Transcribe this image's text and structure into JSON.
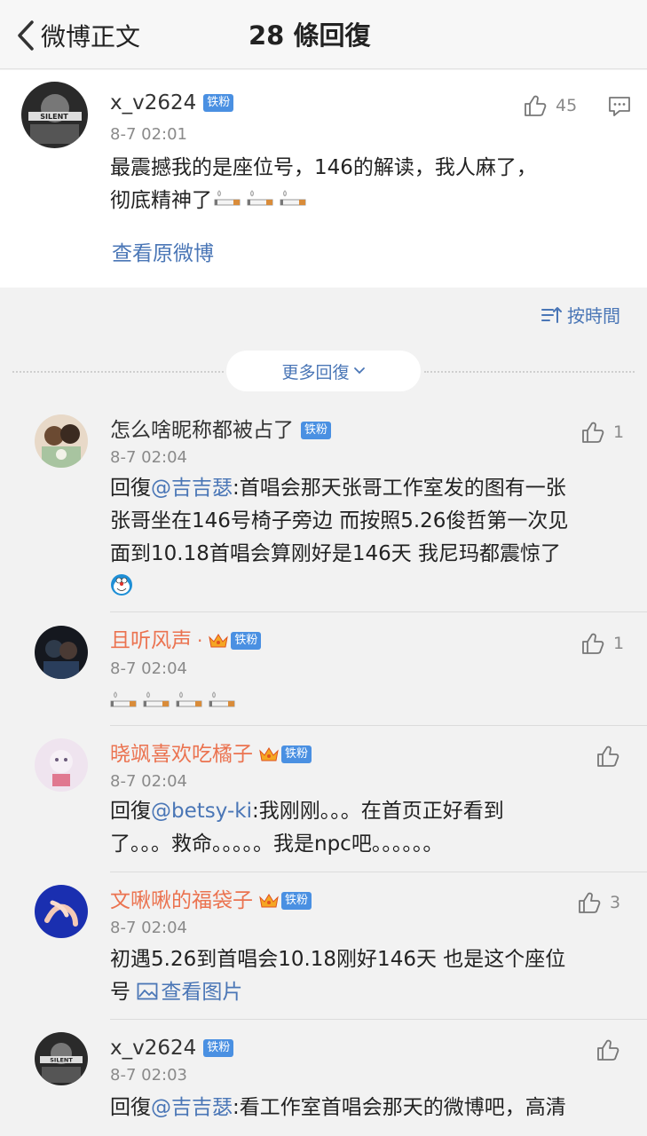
{
  "header": {
    "back_label": "微博正文",
    "title": "28 條回復"
  },
  "main_post": {
    "username": "x_v2624",
    "badge": "铁粉",
    "time": "8-7 02:01",
    "text_line1": "最震撼我的是座位号，146的解读，我人麻了，",
    "text_line2": "彻底精神了",
    "likes": "45",
    "view_original": "查看原微博"
  },
  "sort": {
    "label": "按時間"
  },
  "more_replies": {
    "label": "更多回復"
  },
  "replies": [
    {
      "username": "怎么啥昵称都被占了",
      "badge": "铁粉",
      "time": "8-7 02:04",
      "likes": "1",
      "reply_prefix": "回復",
      "mention": "@吉吉瑟",
      "line1": ":首唱会那天张哥工作室发的图有一张",
      "line2": "张哥坐在146号椅子旁边 而按照5.26俊哲第一次见",
      "line3": "面到10.18首唱会算刚好是146天 我尼玛都震惊了"
    },
    {
      "username": "且听风声",
      "separator": "·",
      "badge": "铁粉",
      "time": "8-7 02:04",
      "likes": "1"
    },
    {
      "username": "晓飒喜欢吃橘子",
      "badge": "铁粉",
      "time": "8-7 02:04",
      "likes": "",
      "reply_prefix": "回復",
      "mention": "@betsy-ki",
      "line1": ":我刚刚。。。在首页正好看到",
      "line2": "了。。。救命。。。。。我是npc吧。。。。。。"
    },
    {
      "username": "文啾啾的福袋子",
      "badge": "铁粉",
      "time": "8-7 02:04",
      "likes": "3",
      "line1": "初遇5.26到首唱会10.18刚好146天 也是这个座位",
      "line2": "号 ",
      "view_image": "查看图片"
    },
    {
      "username": "x_v2624",
      "badge": "铁粉",
      "time": "8-7 02:03",
      "likes": "",
      "reply_prefix": "回復",
      "mention": "@吉吉瑟",
      "line1": ":看工作室首唱会那天的微博吧，高清"
    }
  ],
  "colors": {
    "link": "#4a76b6",
    "vip_name": "#eb7350",
    "badge": "#4a90e2",
    "meta": "#8a8a8a"
  }
}
